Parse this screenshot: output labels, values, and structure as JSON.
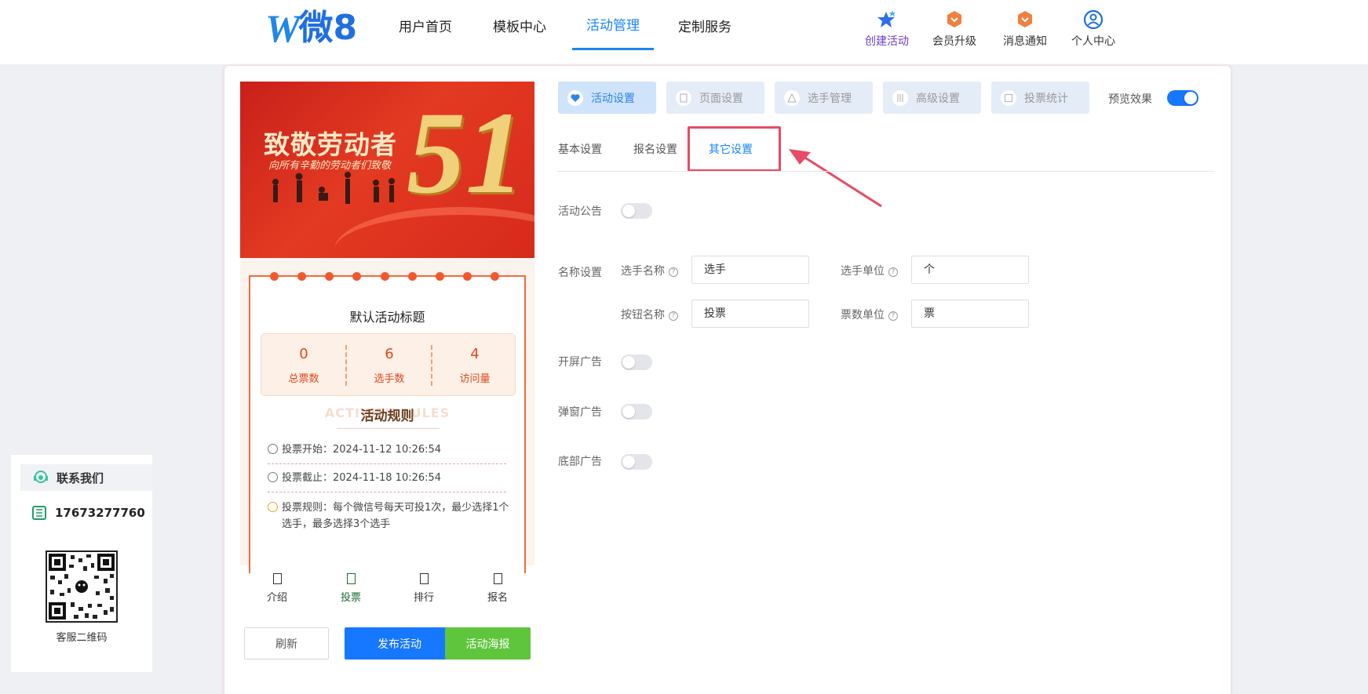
{
  "header": {
    "logo_mark": "W",
    "logo_text": "微8",
    "nav": [
      "用户首页",
      "模板中心",
      "活动管理",
      "定制服务"
    ],
    "active_nav": "活动管理",
    "actions": [
      {
        "label": "创建活动",
        "icon": "star-icon",
        "color": "#6a3fc7"
      },
      {
        "label": "会员升级",
        "icon": "vip-badge-icon",
        "color": "#333333"
      },
      {
        "label": "消息通知",
        "icon": "bell-badge-icon",
        "color": "#333333"
      },
      {
        "label": "个人中心",
        "icon": "user-circle-icon",
        "color": "#333333"
      }
    ]
  },
  "preview": {
    "banner_title": "致敬劳动者",
    "banner_subtitle": "向所有辛勤的劳动者们致敬",
    "banner_number": "51",
    "activity_title": "默认活动标题",
    "stats": [
      {
        "value": "0",
        "label": "总票数"
      },
      {
        "value": "6",
        "label": "选手数"
      },
      {
        "value": "4",
        "label": "访问量"
      }
    ],
    "rules_bg": "ACTIVITY RULES",
    "rules_title": "活动规则",
    "vote_start": "投票开始：2024-11-12 10:26:54",
    "vote_end": "投票截止：2024-11-18 10:26:54",
    "vote_rule": "投票规则：每个微信号每天可投1次，最少选择1个选手，最多选择3个选手",
    "bottom_nav": [
      "介绍",
      "投票",
      "排行",
      "报名"
    ],
    "active_bottom_nav": "投票"
  },
  "buttons": {
    "refresh": "刷新",
    "publish": "发布活动",
    "poster": "活动海报"
  },
  "tabs": [
    "活动设置",
    "页面设置",
    "选手管理",
    "高级设置",
    "投票统计"
  ],
  "active_tab": "活动设置",
  "preview_toggle": {
    "label": "预览效果",
    "on": true
  },
  "subtabs": [
    "基本设置",
    "报名设置",
    "其它设置"
  ],
  "active_subtab": "其它设置",
  "settings": {
    "announcement": {
      "label": "活动公告",
      "on": false
    },
    "names_label": "名称设置",
    "player_name": {
      "label": "选手名称",
      "value": "选手"
    },
    "player_unit": {
      "label": "选手单位",
      "value": "个"
    },
    "button_name": {
      "label": "按钮名称",
      "value": "投票"
    },
    "vote_unit": {
      "label": "票数单位",
      "value": "票"
    },
    "splash_ad": {
      "label": "开屏广告",
      "on": false
    },
    "popup_ad": {
      "label": "弹窗广告",
      "on": false
    },
    "bottom_ad": {
      "label": "底部广告",
      "on": false
    }
  },
  "contact": {
    "title": "联系我们",
    "phone": "17673277760",
    "qr_caption": "客服二维码"
  },
  "colors": {
    "accent": "#1677ff",
    "highlight": "#ea4a63",
    "green": "#5ec53c"
  }
}
